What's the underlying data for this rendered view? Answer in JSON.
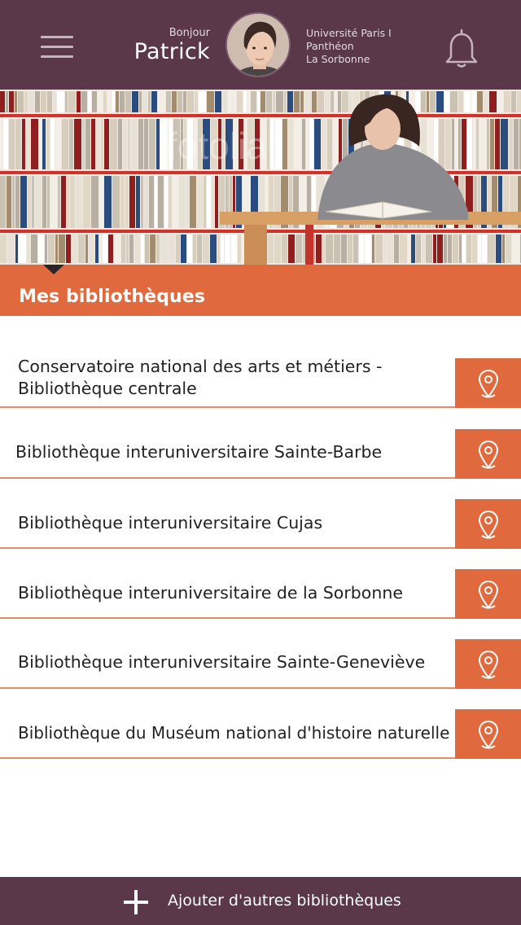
{
  "header": {
    "greeting": "Bonjour",
    "user_name": "Patrick",
    "university_lines": [
      "Université Paris I",
      "Panthéon",
      "La Sorbonne"
    ],
    "icons": {
      "menu": "hamburger-icon",
      "notifications": "bell-icon"
    }
  },
  "banner": {
    "watermark": "fotolia"
  },
  "section": {
    "title": "Mes bibliothèques"
  },
  "libraries": [
    {
      "name_line1": "Conservatoire national des arts et métiers -",
      "name_line2": "Bibliothèque centrale"
    },
    {
      "name_line1": "Bibliothèque interuniversitaire Sainte-Barbe"
    },
    {
      "name_line1": "Bibliothèque interuniversitaire Cujas"
    },
    {
      "name_line1": "Bibliothèque interuniversitaire de la Sorbonne"
    },
    {
      "name_line1": "Bibliothèque interuniversitaire Sainte-Geneviève"
    },
    {
      "name_line1": "Bibliothèque du Muséum national d'histoire naturelle"
    }
  ],
  "footer": {
    "add_label": "Ajouter d'autres bibliothèques",
    "icon": "plus-icon"
  },
  "colors": {
    "header_bg": "#5b3849",
    "accent": "#e06a3e",
    "text": "#222222"
  }
}
